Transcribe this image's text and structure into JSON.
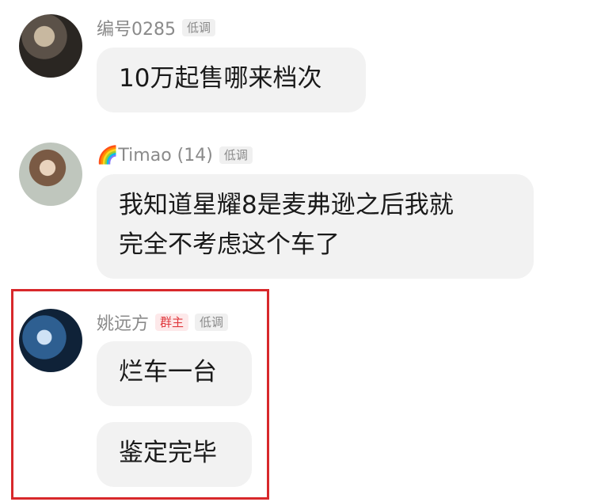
{
  "messages": [
    {
      "sender": "编号0285",
      "tags": [
        "低调"
      ],
      "avatar_icon": "user-avatar-icon",
      "lines": [
        "10万起售哪来档次"
      ]
    },
    {
      "sender": "Timao (14)",
      "sender_emoji": "🌈",
      "tags": [
        "低调"
      ],
      "avatar_icon": "user-avatar-icon",
      "lines": [
        "我知道星耀8是麦弗逊之后我就",
        "完全不考虑这个车了"
      ]
    },
    {
      "sender": "姚远方",
      "owner_tag": "群主",
      "tags": [
        "低调"
      ],
      "avatar_icon": "user-avatar-icon",
      "bubbles": [
        "烂车一台",
        "鉴定完毕"
      ]
    }
  ],
  "colors": {
    "highlight_border": "#d8282b",
    "owner_tag": "#e0393e",
    "bubble_bg": "#f2f2f2",
    "name_text": "#8a8a8a"
  }
}
